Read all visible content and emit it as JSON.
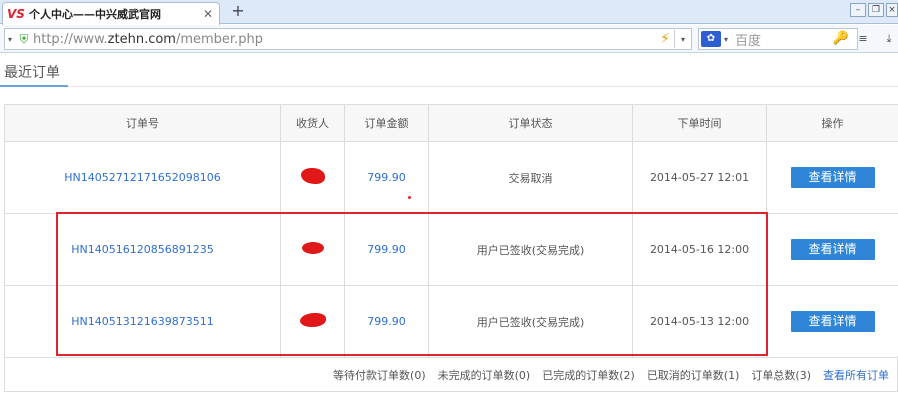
{
  "browser": {
    "tab_logo": "VS",
    "tab_title": "个人中心——中兴威武官网",
    "new_tab": "+",
    "url_prefix": "http://www.",
    "url_host": "ztehn.com",
    "url_path": "/member.php",
    "search_placeholder": "百度",
    "search_engine_icon": "baidu-paw-icon"
  },
  "page": {
    "heading": "最近订单"
  },
  "table": {
    "headers": [
      "订单号",
      "收货人",
      "订单金额",
      "订单状态",
      "下单时间",
      "操作"
    ],
    "rows": [
      {
        "order_no": "HN14052712171652098106",
        "amount": "799.90",
        "status": "交易取消",
        "time": "2014-05-27 12:01",
        "action": "查看详情"
      },
      {
        "order_no": "HN140516120856891235",
        "amount": "799.90",
        "status": "用户已签收(交易完成)",
        "time": "2014-05-16 12:00",
        "action": "查看详情"
      },
      {
        "order_no": "HN140513121639873511",
        "amount": "799.90",
        "status": "用户已签收(交易完成)",
        "time": "2014-05-13 12:00",
        "action": "查看详情"
      }
    ]
  },
  "footer": {
    "pending_payment": "等待付款订单数(0)",
    "incomplete": "未完成的订单数(0)",
    "completed": "已完成的订单数(2)",
    "cancelled": "已取消的订单数(1)",
    "total": "订单总数(3)",
    "view_all": "查看所有订单"
  },
  "colors": {
    "link": "#2f6fcf",
    "button": "#2f86d6",
    "highlight": "#e0242f"
  }
}
